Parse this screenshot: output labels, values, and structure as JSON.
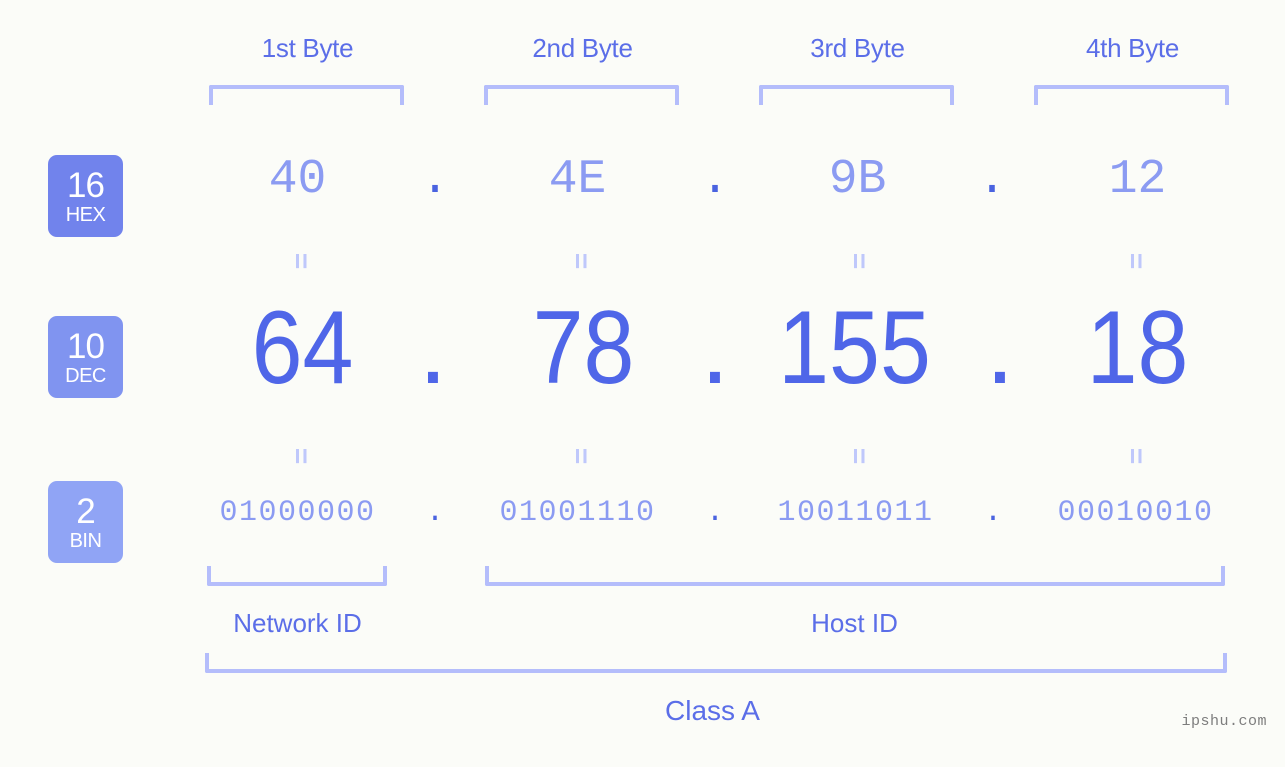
{
  "meta": {
    "watermark": "ipshu.com",
    "background_color": "#fbfcf8",
    "accent_color": "#5b6ee8",
    "light_accent_color": "#b4bdfb",
    "value_color": "#8b9bf2",
    "dec_color": "#4f66e8"
  },
  "byte_headers": [
    {
      "label": "1st Byte"
    },
    {
      "label": "2nd Byte"
    },
    {
      "label": "3rd Byte"
    },
    {
      "label": "4th Byte"
    }
  ],
  "bases": [
    {
      "number": "16",
      "name": "HEX",
      "color": "#7183ec"
    },
    {
      "number": "10",
      "name": "DEC",
      "color": "#8094f0"
    },
    {
      "number": "2",
      "name": "BIN",
      "color": "#90a4f5"
    }
  ],
  "rows": {
    "hex": {
      "octets": [
        "40",
        "4E",
        "9B",
        "12"
      ],
      "separator": "."
    },
    "dec": {
      "octets": [
        "64",
        "78",
        "155",
        "18"
      ],
      "separator": "."
    },
    "bin": {
      "octets": [
        "01000000",
        "01001110",
        "10011011",
        "00010010"
      ],
      "separator": "."
    }
  },
  "equals_glyph": "=",
  "segments": {
    "network_id": "Network ID",
    "host_id": "Host ID",
    "class": "Class A"
  },
  "address": {
    "dotted_decimal": "64.78.155.18",
    "hex": "40.4E.9B.12",
    "binary": "01000000.01001110.10011011.00010010",
    "class": "Class A"
  }
}
